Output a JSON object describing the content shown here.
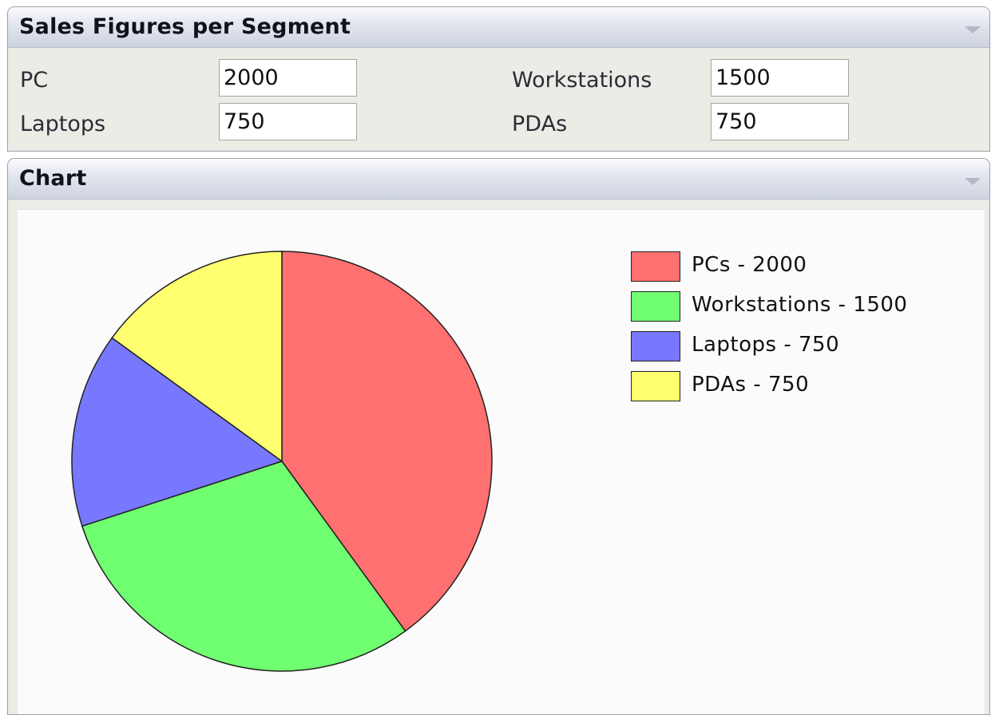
{
  "sales_panel": {
    "title": "Sales Figures per Segment",
    "fields": [
      {
        "label": "PC",
        "value": "2000"
      },
      {
        "label": "Workstations",
        "value": "1500"
      },
      {
        "label": "Laptops",
        "value": "750"
      },
      {
        "label": "PDAs",
        "value": "750"
      }
    ]
  },
  "chart_panel": {
    "title": "Chart"
  },
  "chart_data": {
    "type": "pie",
    "categories": [
      "PCs",
      "Workstations",
      "Laptops",
      "PDAs"
    ],
    "values": [
      2000,
      1500,
      750,
      750
    ],
    "colors": [
      "#ff7070",
      "#70ff70",
      "#7878ff",
      "#ffff70"
    ],
    "legend": [
      "PCs - 2000",
      "Workstations - 1500",
      "Laptops - 750",
      "PDAs - 750"
    ],
    "legend_position": "right"
  }
}
